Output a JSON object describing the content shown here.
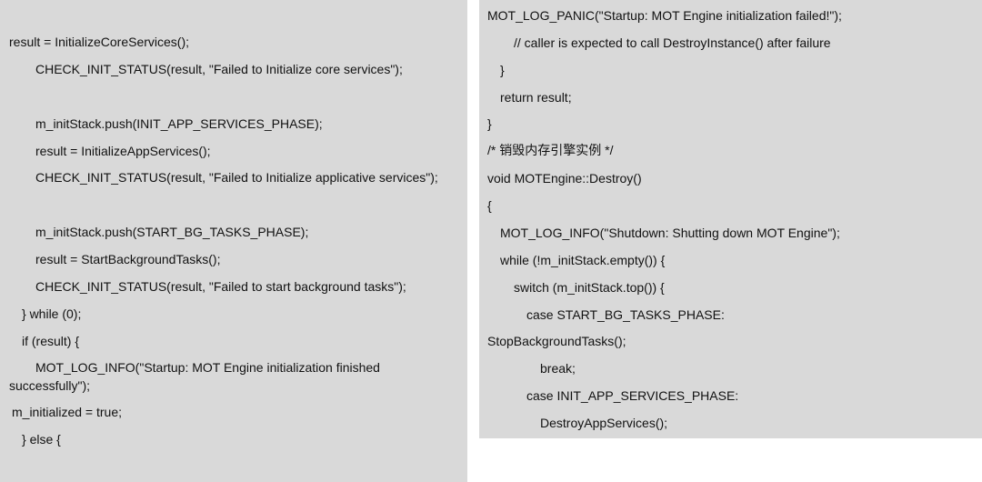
{
  "left_code": [
    "result = InitializeCoreServices();",
    "CHECK_INIT_STATUS(result, \"Failed to Initialize core services\");",
    "m_initStack.push(INIT_APP_SERVICES_PHASE);",
    "result = InitializeAppServices();",
    "CHECK_INIT_STATUS(result, \"Failed to Initialize applicative services\");",
    "m_initStack.push(START_BG_TASKS_PHASE);",
    "result = StartBackgroundTasks();",
    "CHECK_INIT_STATUS(result, \"Failed to start background tasks\");",
    "} while (0);",
    "if (result) {",
    "MOT_LOG_INFO(\"Startup: MOT Engine initialization finished",
    "successfully\");",
    "m_initialized = true;",
    "} else {"
  ],
  "right_code": [
    "MOT_LOG_PANIC(\"Startup: MOT Engine initialization failed!\");",
    "// caller is expected to call DestroyInstance() after failure",
    "}",
    "return result;",
    "}",
    "/* 销毁内存引擎实例 */",
    "void MOTEngine::Destroy()",
    "{",
    "MOT_LOG_INFO(\"Shutdown: Shutting down MOT Engine\");",
    "while (!m_initStack.empty()) {",
    "switch (m_initStack.top()) {",
    "case START_BG_TASKS_PHASE:",
    "StopBackgroundTasks();",
    "break;",
    "case INIT_APP_SERVICES_PHASE:",
    "DestroyAppServices();"
  ]
}
